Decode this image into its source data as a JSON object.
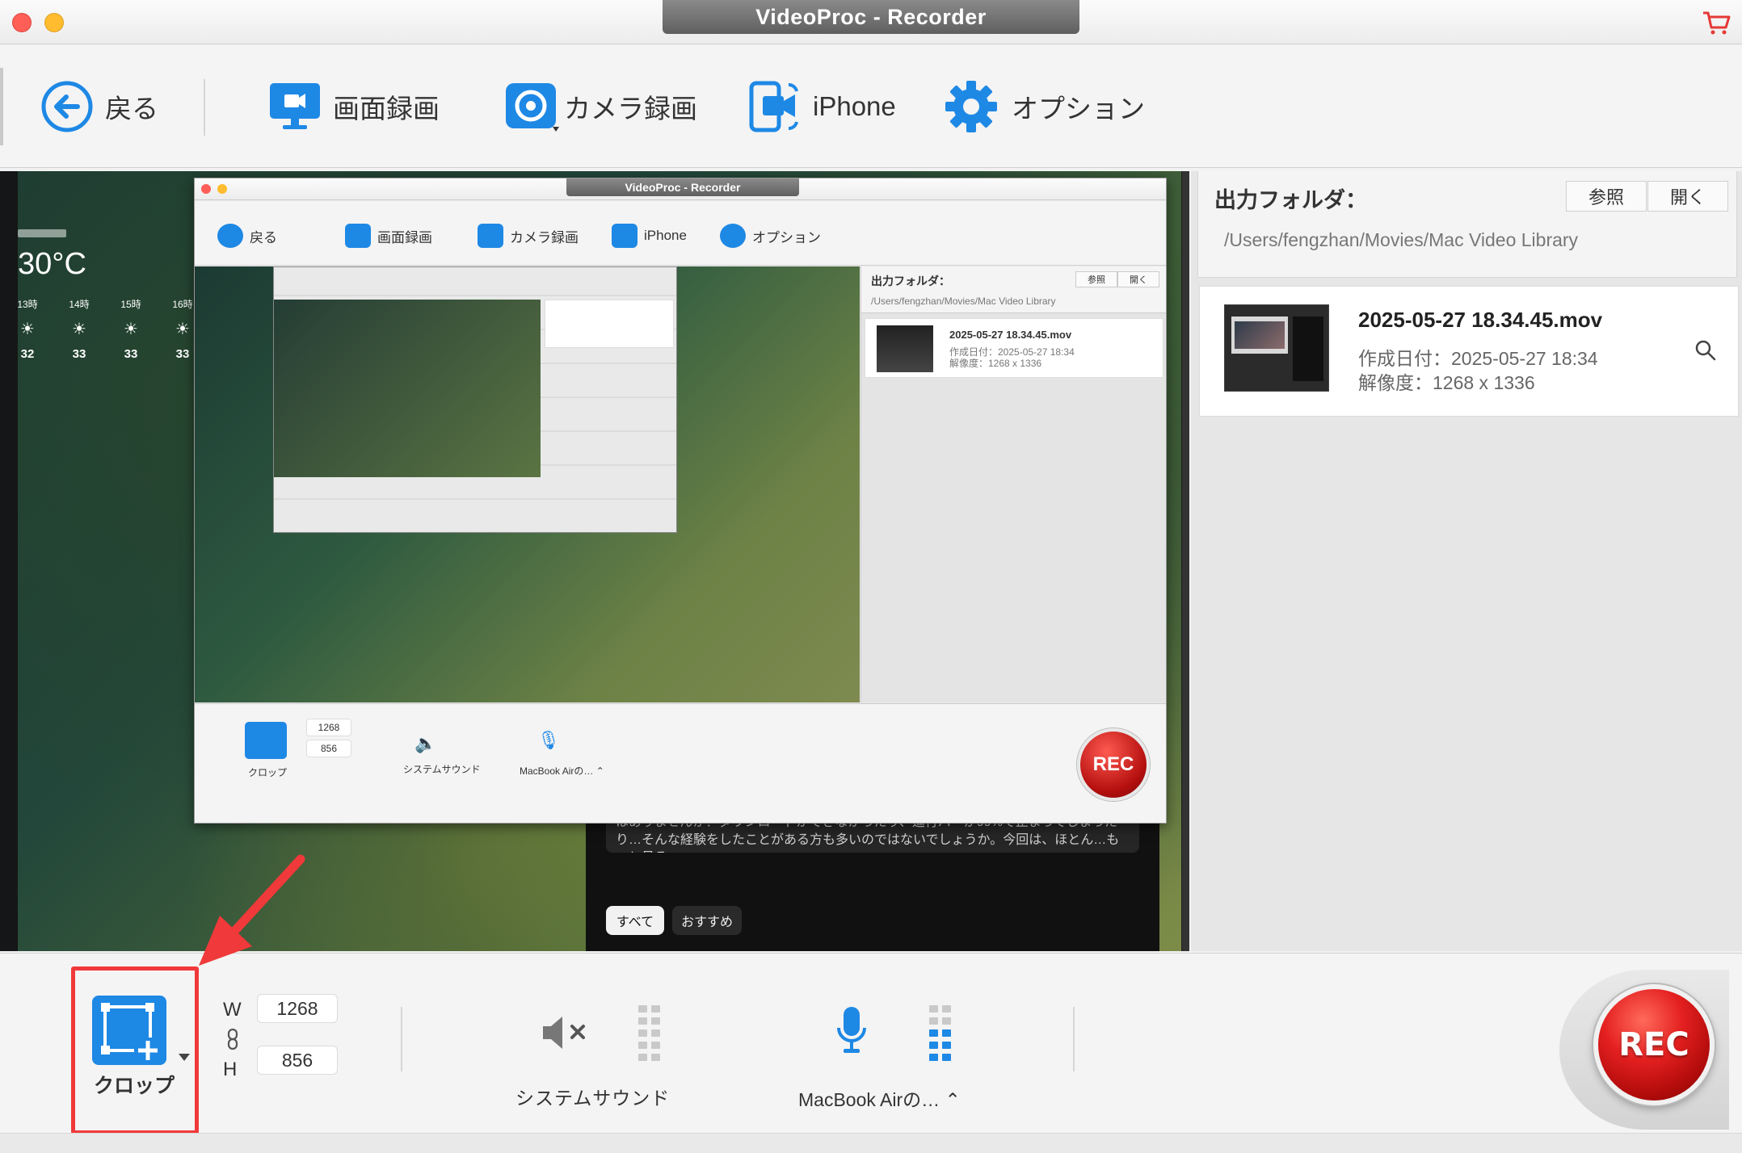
{
  "window": {
    "title": "VideoProc - Recorder"
  },
  "toolbar": {
    "back_label": "戻る",
    "screen_record_label": "画面録画",
    "camera_record_label": "カメラ録画",
    "iphone_label": "iPhone",
    "options_label": "オプション"
  },
  "preview": {
    "weather_temp": "30°C",
    "weather_hours": [
      {
        "hour": "13時",
        "temp": "32"
      },
      {
        "hour": "14時",
        "temp": "33"
      },
      {
        "hour": "15時",
        "temp": "33"
      },
      {
        "hour": "16時",
        "temp": "33"
      }
    ],
    "feed_text": "ジェクサイトで見つけたお気に入りの動画をダウンロードして保存したいと思ったことはありませんか？ダウンロードができなかったり、進行バーが99%で止まってしまったり…そんな経験をしたことがある方も多いのではないでしょうか。今回は、ほとん…もっと見る",
    "chip_all": "すべて",
    "chip_recommended": "おすすめ",
    "nested": {
      "title": "VideoProc - Recorder",
      "back": "戻る",
      "screen": "画面録画",
      "camera": "カメラ録画",
      "iphone": "iPhone",
      "options": "オプション",
      "output_label": "出力フォルダ：",
      "output_path": "/Users/fengzhan/Movies/Mac Video Library",
      "browse": "参照",
      "open": "開く",
      "file_name": "2025-05-27 18.34.45.mov",
      "file_date": "作成日付：2025-05-27 18:34",
      "file_res": "解像度：1268 x 1336",
      "crop": "クロップ",
      "w": "1268",
      "h": "856",
      "sound": "システムサウンド",
      "mic": "MacBook Airの… ⌃",
      "rec": "REC"
    }
  },
  "output": {
    "label": "出力フォルダ：",
    "browse_label": "参照",
    "open_label": "開く",
    "path": "/Users/fengzhan/Movies/Mac Video Library",
    "file": {
      "name": "2025-05-27 18.34.45.mov",
      "created": "作成日付：2025-05-27 18:34",
      "resolution": "解像度：1268 x 1336"
    }
  },
  "bottom": {
    "crop_label": "クロップ",
    "w_label": "W",
    "h_label": "H",
    "width_value": "1268",
    "height_value": "856",
    "system_sound_label": "システムサウンド",
    "mic_label": "MacBook Airの… ⌃",
    "rec_label": "REC"
  },
  "icons": {
    "back": "back-arrow-icon",
    "screen": "monitor-camera-icon",
    "camera": "camera-icon",
    "iphone": "iphone-camera-icon",
    "options": "gear-icon",
    "cart": "cart-icon",
    "crop": "crop-add-icon",
    "link": "link-icon",
    "sound": "speaker-muted-icon",
    "mic": "microphone-icon",
    "search": "search-icon"
  },
  "colors": {
    "accent_blue": "#1e88e5",
    "rec_red": "#e42020",
    "highlight_red": "#f0393a"
  }
}
